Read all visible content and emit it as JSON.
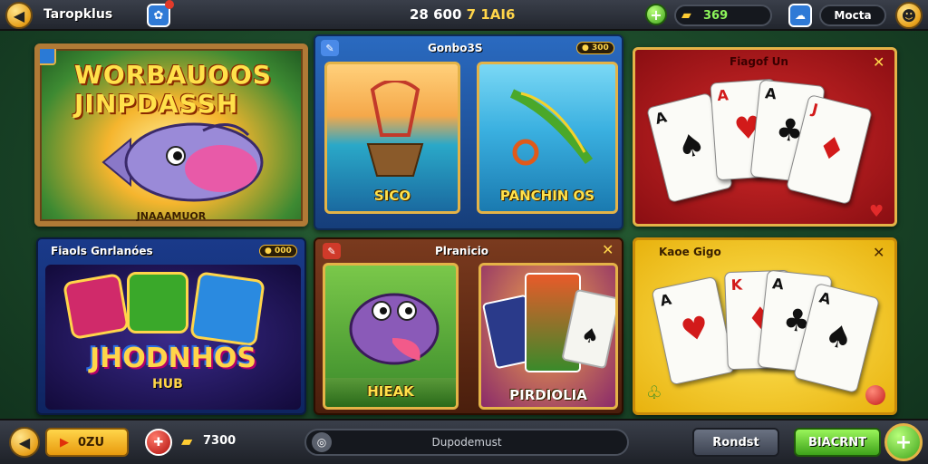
{
  "header": {
    "title": "Taropklus",
    "center_text": "28 600",
    "center_text_gold": "7 1AI6",
    "coins_value": "369",
    "mode_label": "Mocta"
  },
  "featured": {
    "title_line1": "WORBAUOOS",
    "title_line2": "JINPDASSH",
    "caption": "JNAAAMUOR"
  },
  "panel_fishing": {
    "title": "Gonbo3S",
    "badge": "300",
    "tiles": [
      {
        "label": "SICO"
      },
      {
        "label": "PANCHIN OS"
      }
    ]
  },
  "panel_cards1": {
    "title": "Fiagof Un",
    "ranks": [
      "A",
      "A",
      "A",
      "J"
    ]
  },
  "panel_hub": {
    "title": "Fiaols Gnrlanóes",
    "badge": "000",
    "logo_line1": "JHODNHOS",
    "logo_line2": "HUB"
  },
  "panel_mix": {
    "title": "Plranicio",
    "tiles": [
      {
        "label": "HIEAK"
      },
      {
        "label": "PIRDIOLIA"
      }
    ]
  },
  "panel_cards2": {
    "title": "Kaoe Gigo",
    "ranks": [
      "A",
      "K",
      "A",
      "A"
    ]
  },
  "footer": {
    "play_label": "0ZU",
    "coins_value": "7300",
    "search_text": "Dupodemust",
    "btn_secondary": "Rondst",
    "btn_primary": "BIACRNT"
  },
  "colors": {
    "accent_gold": "#e4b347",
    "panel_blue": "#1e5aa8",
    "panel_red": "#b4161b",
    "panel_yellow": "#f2c41c",
    "green": "#5ec22a"
  }
}
